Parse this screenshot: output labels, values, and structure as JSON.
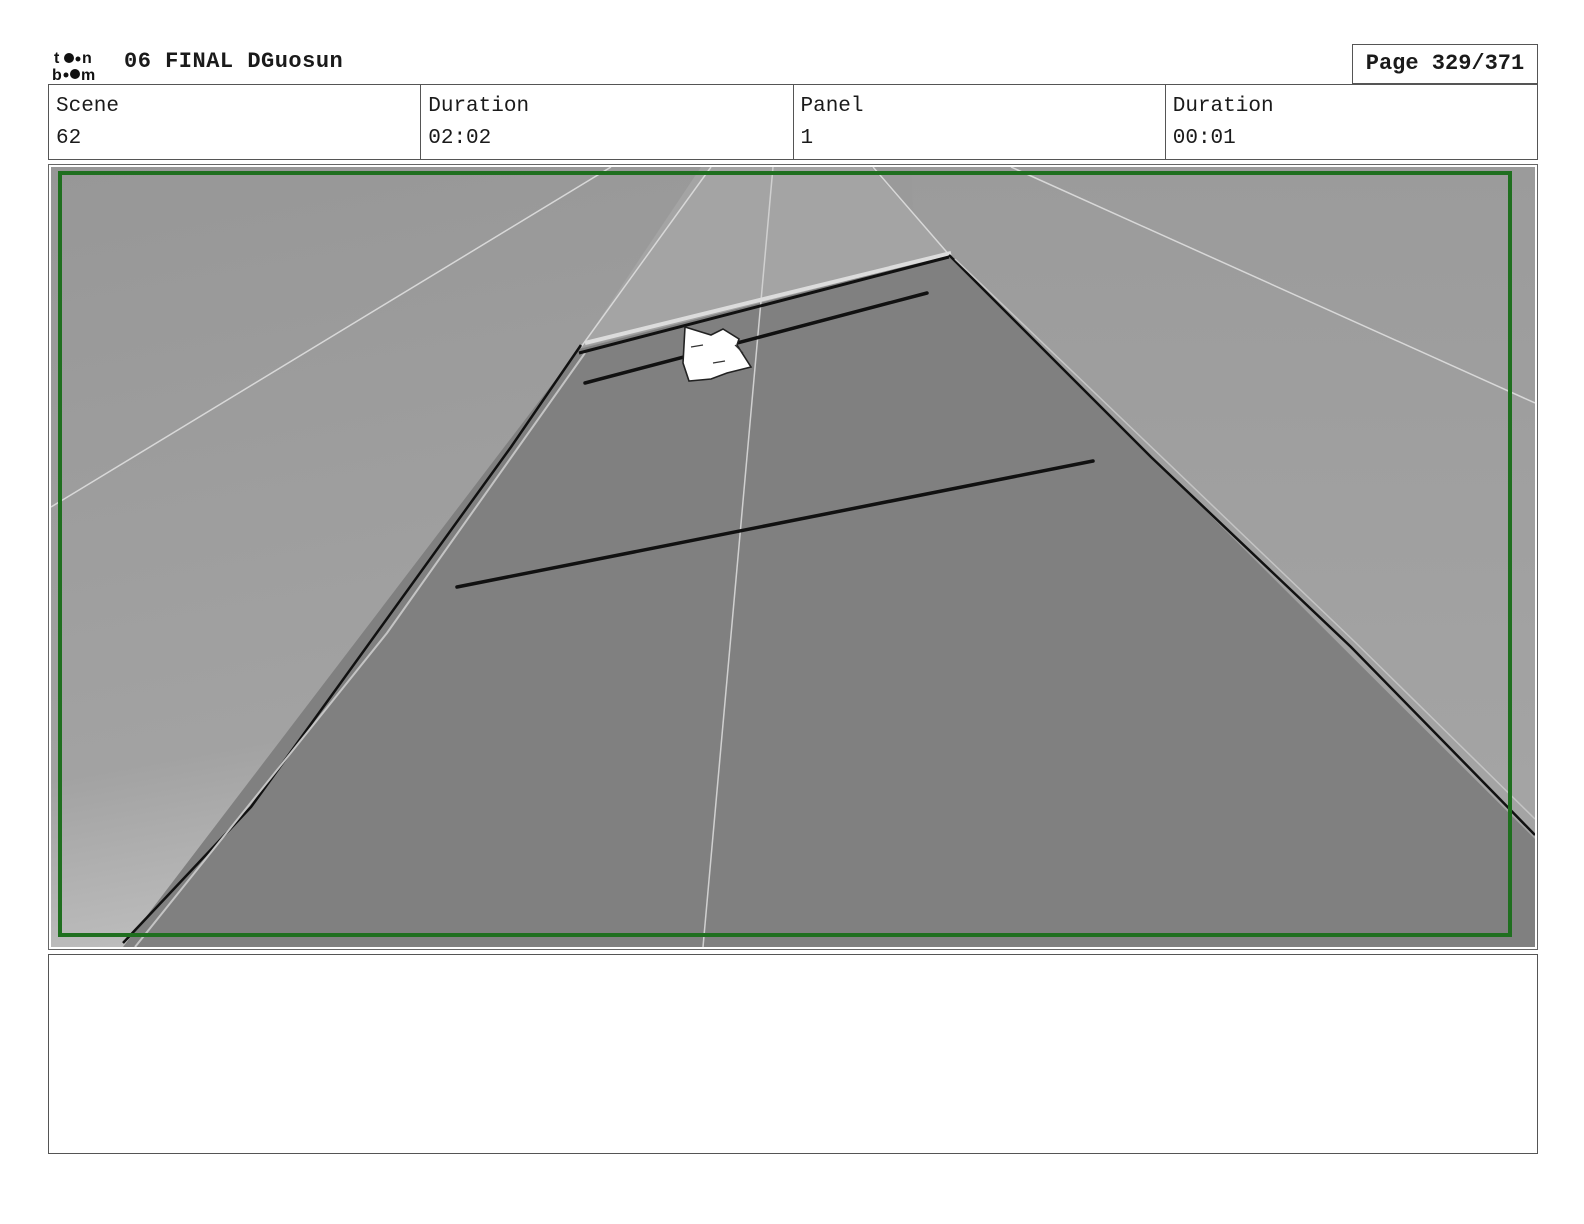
{
  "header": {
    "logo_icon": "toonboom-logo-icon",
    "logo_text_top": "to•n",
    "logo_text_bottom": "b•om",
    "title": "06 FINAL DGuosun",
    "page": "Page 329/371"
  },
  "info": {
    "scene_label": "Scene",
    "scene_value": "62",
    "scene_duration_label": "Duration",
    "scene_duration_value": "02:02",
    "panel_label": "Panel",
    "panel_value": "1",
    "panel_duration_label": "Duration",
    "panel_duration_value": "00:01"
  },
  "panel": {
    "frame_color": "#1f6f1f",
    "floor_color": "#808080",
    "wall_color": "#9a9a9a"
  },
  "notes": {
    "text": ""
  }
}
